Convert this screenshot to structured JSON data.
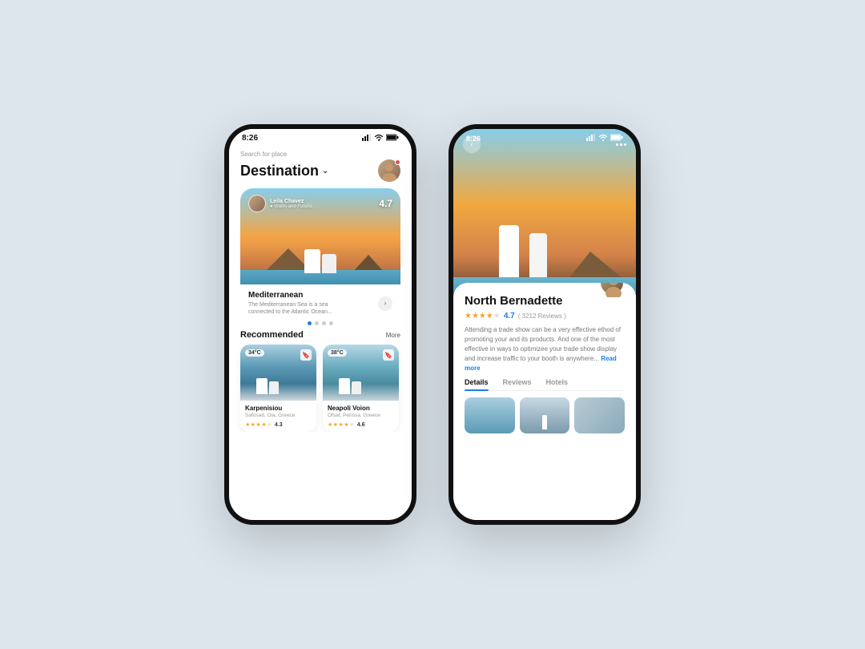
{
  "page": {
    "bg_color": "#dde6ed"
  },
  "phone1": {
    "status_bar": {
      "time": "8:26",
      "signal": "▌▌▌",
      "wifi": "⊛",
      "battery": "▮"
    },
    "header": {
      "search_label": "Search for place",
      "title": "Destination",
      "chevron": "∨"
    },
    "hero_card": {
      "user_name": "Leila Chavez",
      "user_location": "● Wallis and Futuna",
      "rating": "4.7",
      "place_name": "Mediterranean",
      "place_desc": "The Mediterranean Sea is a sea connected to the Atlantic Ocean...",
      "arrow": "›"
    },
    "dots": [
      "active",
      "inactive",
      "inactive",
      "inactive"
    ],
    "recommended": {
      "title": "Recommended",
      "more": "More"
    },
    "cards": [
      {
        "temp": "34°C",
        "name": "Karpenisiou",
        "location": "Safosad, Oia, Greece",
        "rating": "4.3",
        "stars": 4
      },
      {
        "temp": "38°C",
        "name": "Neapoli Voion",
        "location": "Ofsaf, Perissa, Greece",
        "rating": "4.6",
        "stars": 4
      }
    ]
  },
  "phone2": {
    "status_bar": {
      "time": "8:26",
      "signal": "▌▌▌",
      "wifi": "⊛",
      "battery": "▮"
    },
    "nav": {
      "back": "‹",
      "menu_dots": [
        "•",
        "•",
        "•"
      ]
    },
    "dots": [
      "inactive",
      "active",
      "inactive",
      "inactive"
    ],
    "detail": {
      "place_name": "North Bernadette",
      "rating": "4.7",
      "reviews_count": "3212 Reviews",
      "description": "Attending a trade show can be a very effective ethod of promoting your and its products. And one of the most effective in ways to optimizee your trade show display and increase traffic to your booth is anywhere...",
      "read_more": "Read more",
      "stars": 4
    },
    "tabs": [
      {
        "label": "Details",
        "active": true
      },
      {
        "label": "Reviews",
        "active": false
      },
      {
        "label": "Hotels",
        "active": false
      }
    ]
  }
}
